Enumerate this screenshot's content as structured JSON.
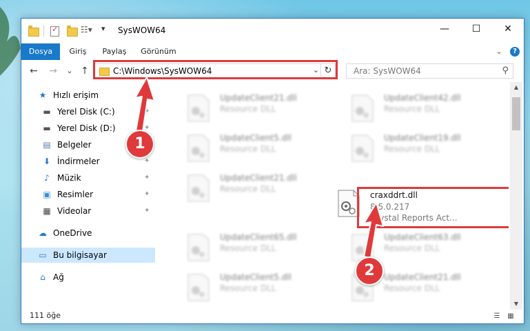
{
  "window": {
    "title": "SysWOW64"
  },
  "titlebar_buttons": {
    "minimize": "—",
    "maximize": "☐",
    "close": "✕"
  },
  "ribbon": {
    "tabs": [
      {
        "label": "Dosya",
        "active": true
      },
      {
        "label": "Giriş"
      },
      {
        "label": "Paylaş"
      },
      {
        "label": "Görünüm"
      }
    ],
    "help": "?",
    "collapse": "⌄"
  },
  "nav": {
    "back": "←",
    "forward": "→",
    "recent": "⌄",
    "up": "↑",
    "address": "C:\\Windows\\SysWOW64",
    "address_drop": "⌄",
    "refresh": "↻",
    "search_placeholder": "Ara: SysWOW64",
    "search_icon": "⚲"
  },
  "sidebar": {
    "items": [
      {
        "label": "Hızlı erişim",
        "icon": "star-icon",
        "glyph": "★",
        "color": "#2b78c9",
        "root": true,
        "pin": false
      },
      {
        "label": "Yerel Disk (C:)",
        "icon": "drive-icon",
        "glyph": "▬",
        "color": "#555555",
        "root": false,
        "pin": true
      },
      {
        "label": "Yerel Disk (D:)",
        "icon": "drive-icon",
        "glyph": "▬",
        "color": "#555555",
        "root": false,
        "pin": true
      },
      {
        "label": "Belgeler",
        "icon": "documents-icon",
        "glyph": "▤",
        "color": "#5b7fa8",
        "root": false,
        "pin": true
      },
      {
        "label": "İndirmeler",
        "icon": "download-icon",
        "glyph": "⬇",
        "color": "#2b78c9",
        "root": false,
        "pin": true
      },
      {
        "label": "Müzik",
        "icon": "music-icon",
        "glyph": "♪",
        "color": "#2b78c9",
        "root": false,
        "pin": true
      },
      {
        "label": "Resimler",
        "icon": "pictures-icon",
        "glyph": "▣",
        "color": "#3a8fd6",
        "root": false,
        "pin": true
      },
      {
        "label": "Videolar",
        "icon": "videos-icon",
        "glyph": "▦",
        "color": "#444444",
        "root": false,
        "pin": true
      },
      {
        "label": "OneDrive",
        "icon": "cloud-icon",
        "glyph": "☁",
        "color": "#1979ca",
        "root": true,
        "pin": false
      },
      {
        "label": "Bu bilgisayar",
        "icon": "computer-icon",
        "glyph": "▭",
        "color": "#2b78c9",
        "root": true,
        "pin": false,
        "selected": true
      },
      {
        "label": "Ağ",
        "icon": "network-icon",
        "glyph": "⌂",
        "color": "#2b78c9",
        "root": true,
        "pin": false
      }
    ],
    "pin_glyph": "📌"
  },
  "files": [
    {
      "name": "UpdateClient21.dll",
      "sub": "Resource DLL",
      "blur": true
    },
    {
      "name": "UpdateClient42.dll",
      "sub": "Resource DLL",
      "blur": true
    },
    {
      "name": "UpdateClient5.dll",
      "sub": "Resource DLL",
      "blur": true
    },
    {
      "name": "UpdateClient19.dll",
      "sub": "Resource DLL",
      "blur": true
    },
    {
      "name": "UpdateClient21.dll",
      "sub": "Resource DLL",
      "blur": true
    },
    {
      "name": "craxddrt.dll",
      "sub": "8.5.0.217",
      "sub2": "Crystal Reports Act...",
      "blur": false,
      "highlight": true
    },
    {
      "name": "UpdateClient65.dll",
      "sub": "Resource DLL",
      "blur": true
    },
    {
      "name": "UpdateClient63.dll",
      "sub": "Resource DLL",
      "blur": true
    },
    {
      "name": "UpdateClient5.dll",
      "sub": "Resource DLL",
      "blur": true
    },
    {
      "name": "UpdateClient21.dll",
      "sub": "Resource DLL",
      "blur": true
    }
  ],
  "status": {
    "count": "111 öğe"
  },
  "annotations": {
    "badge1": "1",
    "badge2": "2"
  },
  "colors": {
    "accent": "#1979ca",
    "annotation": "#e0393b",
    "selection": "#cce8ff"
  }
}
